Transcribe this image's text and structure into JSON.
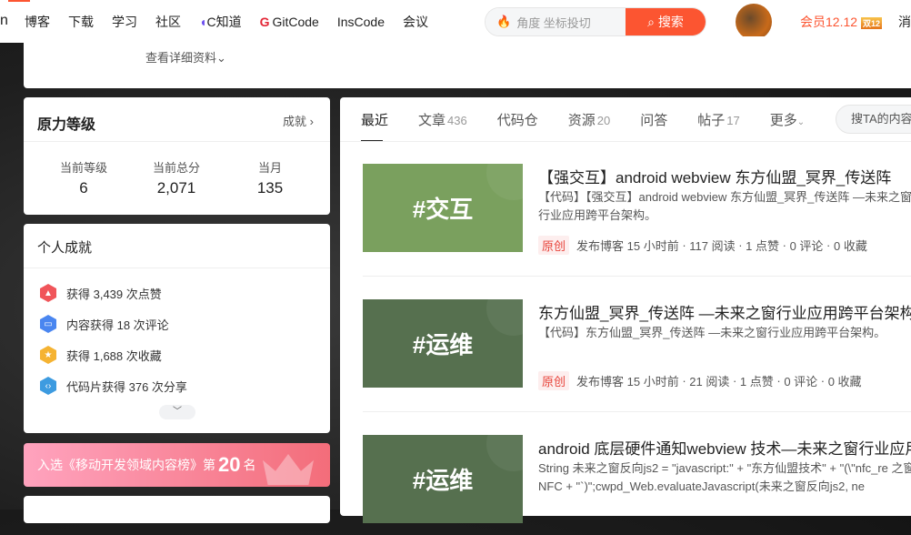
{
  "header": {
    "logo_tail": "n",
    "nav": [
      "博客",
      "下载",
      "学习",
      "社区",
      "C知道",
      "GitCode",
      "InsCode",
      "会议"
    ],
    "search_placeholder": "角度 坐标投切",
    "search_button": "搜索",
    "vip": "会员12.12",
    "vip_badge": "双12",
    "message": "消"
  },
  "profile": {
    "details_link": "查看详细资料"
  },
  "level": {
    "title": "原力等级",
    "link": "成就",
    "stats": [
      {
        "label": "当前等级",
        "value": "6"
      },
      {
        "label": "当前总分",
        "value": "2,071"
      },
      {
        "label": "当月",
        "value": "135"
      }
    ]
  },
  "achievements": {
    "title": "个人成就",
    "items": [
      {
        "text": "获得 3,439 次点赞",
        "icon": "thumb-up-icon",
        "color": "#f0555a"
      },
      {
        "text": "内容获得 18 次评论",
        "icon": "comment-icon",
        "color": "#4a86f0"
      },
      {
        "text": "获得 1,688 次收藏",
        "icon": "star-icon",
        "color": "#f5b332"
      },
      {
        "text": "代码片获得 376 次分享",
        "icon": "code-icon",
        "color": "#3d9be0"
      }
    ]
  },
  "banner": {
    "prefix": "入选《移动开发领域内容榜》第",
    "rank": "20",
    "suffix": "名"
  },
  "tabs": [
    {
      "label": "最近",
      "count": ""
    },
    {
      "label": "文章",
      "count": "436"
    },
    {
      "label": "代码仓",
      "count": ""
    },
    {
      "label": "资源",
      "count": "20"
    },
    {
      "label": "问答",
      "count": ""
    },
    {
      "label": "帖子",
      "count": "17"
    },
    {
      "label": "更多",
      "count": ""
    }
  ],
  "tab_search_placeholder": "搜TA的内容",
  "articles": [
    {
      "tag": "#交互",
      "thumb_color": "#7aa05e",
      "title": "【强交互】android webview 东方仙盟_冥界_传送阵",
      "desc": "【代码】【强交互】android webview 东方仙盟_冥界_传送阵 —未来之窗行业应用跨平台架构。",
      "badge": "原创",
      "time": "发布博客 15 小时前",
      "reads": "117 阅读",
      "likes": "1 点赞",
      "comments": "0 评论",
      "favs": "0 收藏"
    },
    {
      "tag": "#运维",
      "thumb_color": "#56704f",
      "title": "东方仙盟_冥界_传送阵 —未来之窗行业应用跨平台架构",
      "desc": "【代码】东方仙盟_冥界_传送阵 —未来之窗行业应用跨平台架构。",
      "badge": "原创",
      "time": "发布博客 15 小时前",
      "reads": "21 阅读",
      "likes": "1 点赞",
      "comments": "0 评论",
      "favs": "0 收藏"
    },
    {
      "tag": "#运维",
      "thumb_color": "#56704f",
      "title": "android 底层硬件通知webview 技术—未来之窗行业应用",
      "desc": "String 未来之窗反向js2 = \"javascript:\" + \"东方仙盟技术\" + \"(\\\"nfc_re 之窗NFC + \"`)\";cwpd_Web.evaluateJavascript(未来之窗反向js2, ne"
    }
  ]
}
